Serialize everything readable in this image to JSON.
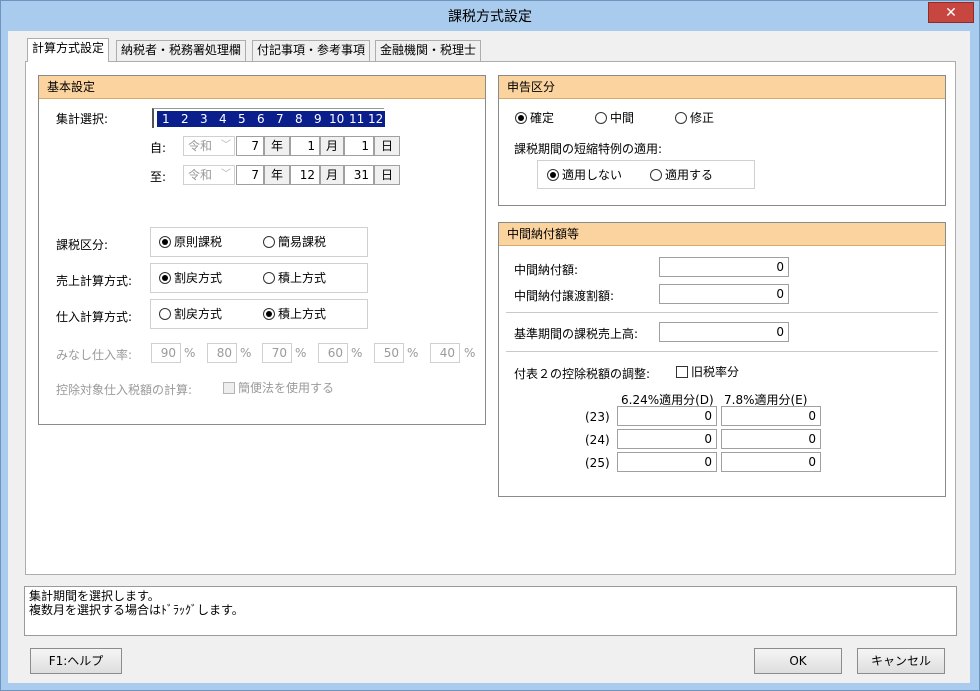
{
  "window": {
    "title": "課税方式設定",
    "close_glyph": "✕"
  },
  "tabs": [
    {
      "label": "計算方式設定"
    },
    {
      "label": "納税者・税務署処理欄"
    },
    {
      "label": "付記事項・参考事項"
    },
    {
      "label": "金融機関・税理士"
    }
  ],
  "kihon": {
    "title": "基本設定",
    "shukei_label": "集計選択:",
    "months": [
      "1",
      "2",
      "3",
      "4",
      "5",
      "6",
      "7",
      "8",
      "9",
      "10",
      "11",
      "12"
    ],
    "from_label": "自:",
    "to_label": "至:",
    "era": "令和",
    "from": {
      "year": "7",
      "year_unit": "年",
      "month": "1",
      "month_unit": "月",
      "day": "1",
      "day_unit": "日"
    },
    "to": {
      "year": "7",
      "year_unit": "年",
      "month": "12",
      "month_unit": "月",
      "day": "31",
      "day_unit": "日"
    },
    "kazei_label": "課税区分:",
    "kazei_options": [
      "原則課税",
      "簡易課税"
    ],
    "uriage_label": "売上計算方式:",
    "uriage_options": [
      "割戻方式",
      "積上方式"
    ],
    "shiire_label": "仕入計算方式:",
    "shiire_options": [
      "割戻方式",
      "積上方式"
    ],
    "minashi_label": "みなし仕入率:",
    "minashi_rates": [
      "90",
      "80",
      "70",
      "60",
      "50",
      "40"
    ],
    "percent": "%",
    "kojo_label": "控除対象仕入税額の計算:",
    "kanben_label": "簡便法を使用する"
  },
  "shinkoku": {
    "title": "申告区分",
    "options": [
      "確定",
      "中間",
      "修正"
    ],
    "tanshuku_label": "課税期間の短縮特例の適用:",
    "tanshuku_options": [
      "適用しない",
      "適用する"
    ]
  },
  "chukan": {
    "title": "中間納付額等",
    "nofu_label": "中間納付額:",
    "nofu_value": "0",
    "joto_label": "中間納付譲渡割額:",
    "joto_value": "0",
    "kijun_label": "基準期間の課税売上高:",
    "kijun_value": "0",
    "fuhyo_label": "付表２の控除税額の調整:",
    "kyu_label": "旧税率分",
    "col_d": "6.24%適用分(D)",
    "col_e": "7.8%適用分(E)",
    "rows": [
      {
        "label": "(23)",
        "d": "0",
        "e": "0"
      },
      {
        "label": "(24)",
        "d": "0",
        "e": "0"
      },
      {
        "label": "(25)",
        "d": "0",
        "e": "0"
      }
    ]
  },
  "status": {
    "line1": "集計期間を選択します。",
    "line2": "複数月を選択する場合はﾄﾞﾗｯｸﾞします。"
  },
  "buttons": {
    "help": "F1:ヘルプ",
    "ok": "OK",
    "cancel": "キャンセル"
  }
}
